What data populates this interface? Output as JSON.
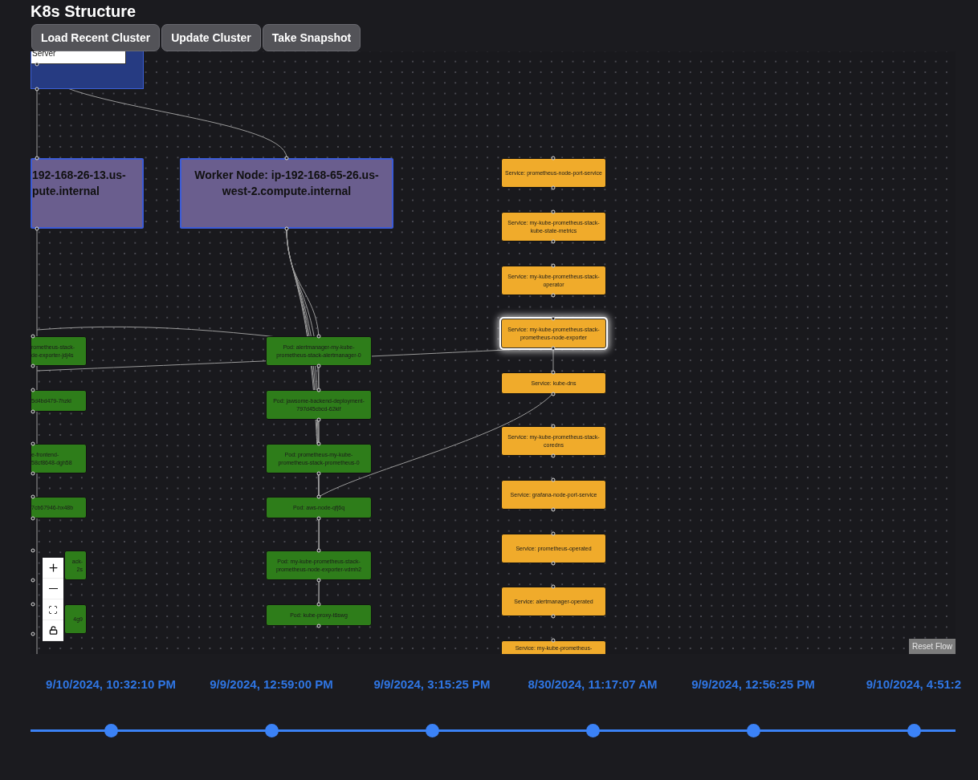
{
  "title": "K8s Structure",
  "toolbar": [
    "Load Recent Cluster",
    "Update Cluster",
    "Take Snapshot"
  ],
  "canvas": {
    "control_plane": {
      "label": "Server"
    },
    "worker_nodes": [
      {
        "label": "192-168-26-13.us-\npute.internal"
      },
      {
        "label": "Worker Node: ip-192-168-65-26.us-west-2.compute.internal"
      }
    ],
    "pods_left": [
      {
        "label": "rometheus-stack-\nde-exporter-jdj4s"
      },
      {
        "label": "5d4bd479-7hzkl"
      },
      {
        "label": "e-frontend-\n58cf8648-dgh58"
      },
      {
        "label": "7cb67946-hx48b"
      },
      {
        "label": "ack-\n2s"
      },
      {
        "label": "4g9"
      }
    ],
    "pods": [
      {
        "label": "Pod: alertmanager-my-kube-prometheus-stack-alertmanager-0"
      },
      {
        "label": "Pod: jawsome-backend-deployment-797d45cbcd-62klf"
      },
      {
        "label": "Pod: prometheus-my-kube-prometheus-stack-prometheus-0"
      },
      {
        "label": "Pod: aws-node-qfj6q"
      },
      {
        "label": "Pod: my-kube-prometheus-stack-prometheus-node-exporter-vdmh2"
      },
      {
        "label": "Pod: kube-proxy-t6swg"
      }
    ],
    "services": [
      {
        "label": "Service: prometheus-node-port-service",
        "selected": false
      },
      {
        "label": "Service: my-kube-prometheus-stack-kube-state-metrics",
        "selected": false
      },
      {
        "label": "Service: my-kube-prometheus-stack-operator",
        "selected": false
      },
      {
        "label": "Service: my-kube-prometheus-stack-prometheus-node-exporter",
        "selected": true
      },
      {
        "label": "Service: kube-dns",
        "selected": false
      },
      {
        "label": "Service: my-kube-prometheus-stack-coredns",
        "selected": false
      },
      {
        "label": "Service: grafana-node-port-service",
        "selected": false
      },
      {
        "label": "Service: prometheus-operated",
        "selected": false
      },
      {
        "label": "Service: alertmanager-operated",
        "selected": false
      },
      {
        "label": "Service: my-kube-prometheus-",
        "selected": false
      }
    ],
    "reset_button": "Reset Flow"
  },
  "timeline": [
    {
      "label": "9/10/2024, 10:32:10 PM"
    },
    {
      "label": "9/9/2024, 12:59:00 PM"
    },
    {
      "label": "9/9/2024, 3:15:25 PM"
    },
    {
      "label": "8/30/2024, 11:17:07 AM"
    },
    {
      "label": "9/9/2024, 12:56:25 PM"
    },
    {
      "label": "9/10/2024, 4:51:2"
    }
  ]
}
